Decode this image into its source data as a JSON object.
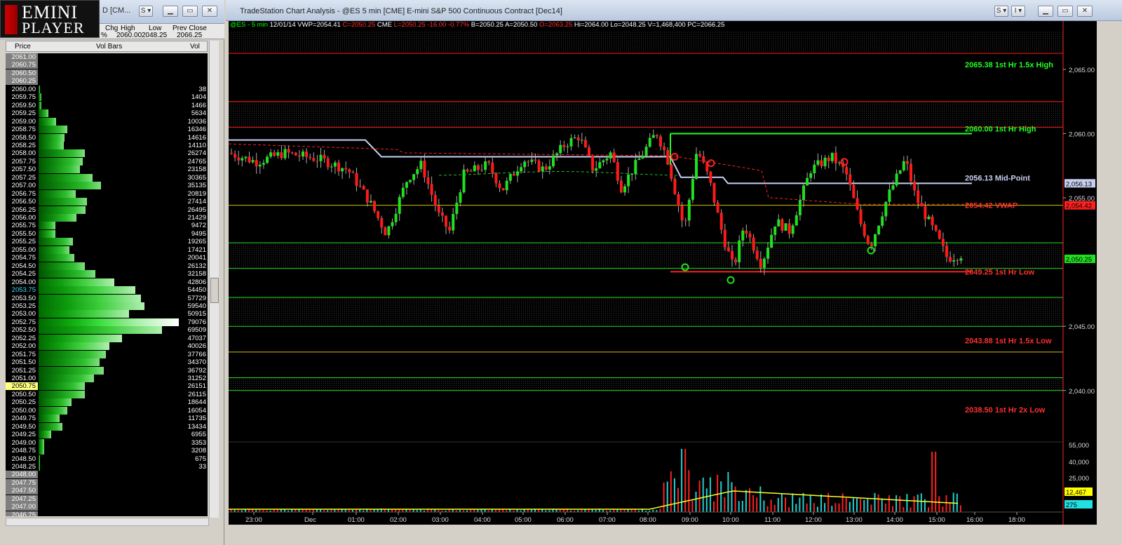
{
  "left_window": {
    "logo_line1": "EMINI",
    "logo_line2": "PLAYER",
    "title_fragment": "D [CM...",
    "header": {
      "cols": [
        "Chg",
        "High",
        "Low",
        "Prev Close"
      ],
      "vals": [
        "%",
        "2060.00",
        "2048.25",
        "2066.25"
      ]
    },
    "columns": [
      "Price",
      "Vol Bars",
      "Vol"
    ],
    "current_price": "2053.75",
    "rows": [
      {
        "price": "2061.00",
        "vol": "",
        "style": "gray"
      },
      {
        "price": "2060.75",
        "vol": "",
        "style": "gray"
      },
      {
        "price": "2060.50",
        "vol": "",
        "style": "gray"
      },
      {
        "price": "2060.25",
        "vol": "",
        "style": "gray"
      },
      {
        "price": "2060.00",
        "vol": "38"
      },
      {
        "price": "2059.75",
        "vol": "1404"
      },
      {
        "price": "2059.50",
        "vol": "1466"
      },
      {
        "price": "2059.25",
        "vol": "5634"
      },
      {
        "price": "2059.00",
        "vol": "10036"
      },
      {
        "price": "2058.75",
        "vol": "16346"
      },
      {
        "price": "2058.50",
        "vol": "14616"
      },
      {
        "price": "2058.25",
        "vol": "14110"
      },
      {
        "price": "2058.00",
        "vol": "26274"
      },
      {
        "price": "2057.75",
        "vol": "24765"
      },
      {
        "price": "2057.50",
        "vol": "23158"
      },
      {
        "price": "2057.25",
        "vol": "30365"
      },
      {
        "price": "2057.00",
        "vol": "35135"
      },
      {
        "price": "2056.75",
        "vol": "20819"
      },
      {
        "price": "2056.50",
        "vol": "27414"
      },
      {
        "price": "2056.25",
        "vol": "26495"
      },
      {
        "price": "2056.00",
        "vol": "21429"
      },
      {
        "price": "2055.75",
        "vol": "9472"
      },
      {
        "price": "2055.50",
        "vol": "9495"
      },
      {
        "price": "2055.25",
        "vol": "19265"
      },
      {
        "price": "2055.00",
        "vol": "17421"
      },
      {
        "price": "2054.75",
        "vol": "20041"
      },
      {
        "price": "2054.50",
        "vol": "26132"
      },
      {
        "price": "2054.25",
        "vol": "32158"
      },
      {
        "price": "2054.00",
        "vol": "42806"
      },
      {
        "price": "2053.75",
        "vol": "54450",
        "style": "cur"
      },
      {
        "price": "2053.50",
        "vol": "57729"
      },
      {
        "price": "2053.25",
        "vol": "59540"
      },
      {
        "price": "2053.00",
        "vol": "50915"
      },
      {
        "price": "2052.75",
        "vol": "79076"
      },
      {
        "price": "2052.50",
        "vol": "69509"
      },
      {
        "price": "2052.25",
        "vol": "47037"
      },
      {
        "price": "2052.00",
        "vol": "40026"
      },
      {
        "price": "2051.75",
        "vol": "37766"
      },
      {
        "price": "2051.50",
        "vol": "34370"
      },
      {
        "price": "2051.25",
        "vol": "36792"
      },
      {
        "price": "2051.00",
        "vol": "31252"
      },
      {
        "price": "2050.75",
        "vol": "26151",
        "style": "hi"
      },
      {
        "price": "2050.50",
        "vol": "26115"
      },
      {
        "price": "2050.25",
        "vol": "18644"
      },
      {
        "price": "2050.00",
        "vol": "16054"
      },
      {
        "price": "2049.75",
        "vol": "11735"
      },
      {
        "price": "2049.50",
        "vol": "13434"
      },
      {
        "price": "2049.25",
        "vol": "6955"
      },
      {
        "price": "2049.00",
        "vol": "3353"
      },
      {
        "price": "2048.75",
        "vol": "3208"
      },
      {
        "price": "2048.50",
        "vol": "675"
      },
      {
        "price": "2048.25",
        "vol": "33"
      },
      {
        "price": "2048.00",
        "vol": "",
        "style": "gray"
      },
      {
        "price": "2047.75",
        "vol": "",
        "style": "gray"
      },
      {
        "price": "2047.50",
        "vol": "",
        "style": "gray"
      },
      {
        "price": "2047.25",
        "vol": "",
        "style": "gray"
      },
      {
        "price": "2047.00",
        "vol": "",
        "style": "gray"
      },
      {
        "price": "2046.75",
        "vol": "",
        "style": "gray"
      }
    ]
  },
  "right_window": {
    "title": "TradeStation Chart Analysis - @ES 5 min [CME] E-mini S&P 500 Continuous Contract [Dec14]",
    "status": [
      {
        "text": "@ES - 5 min",
        "color": "#00ff00"
      },
      {
        "text": "12/01/14",
        "color": "#ffffff"
      },
      {
        "text": "VWP=2054.41",
        "color": "#ffffff"
      },
      {
        "text": "C=2050.25",
        "color": "#ff3030"
      },
      {
        "text": "CME",
        "color": "#ffffff"
      },
      {
        "text": "L=2050.25",
        "color": "#ff3030"
      },
      {
        "text": "-16.00",
        "color": "#ff3030"
      },
      {
        "text": "-0.77%",
        "color": "#ff3030"
      },
      {
        "text": "B=2050.25",
        "color": "#ffffff"
      },
      {
        "text": "A=2050.50",
        "color": "#ffffff"
      },
      {
        "text": "O=2063.25",
        "color": "#ff3030"
      },
      {
        "text": "Hi=2064.00",
        "color": "#ffffff"
      },
      {
        "text": "Lo=2048.25",
        "color": "#ffffff"
      },
      {
        "text": "V=1,468,400",
        "color": "#ffffff"
      },
      {
        "text": "PC=2066.25",
        "color": "#ffffff"
      }
    ]
  },
  "chart_data": {
    "type": "candlestick",
    "symbol": "@ES",
    "interval": "5 min",
    "ylim": [
      2036,
      2068
    ],
    "y_ticks": [
      {
        "v": 2065,
        "label": "2,065.00"
      },
      {
        "v": 2060,
        "label": "2,060.00"
      },
      {
        "v": 2055,
        "label": "2,055.00"
      },
      {
        "v": 2045,
        "label": "2,045.00"
      },
      {
        "v": 2040,
        "label": "2,040.00"
      }
    ],
    "x_ticks": [
      "23:00",
      "Dec",
      "01:00",
      "02:00",
      "03:00",
      "04:00",
      "05:00",
      "06:00",
      "07:00",
      "08:00",
      "09:00",
      "10:00",
      "11:00",
      "12:00",
      "13:00",
      "14:00",
      "15:00",
      "16:00",
      "18:00"
    ],
    "price_tags": [
      {
        "v": 2056.13,
        "label": "2,056.13",
        "bg": "#c8d0f0",
        "fg": "#000000"
      },
      {
        "v": 2054.42,
        "label": "2,054.42",
        "bg": "#ff2020",
        "fg": "#000000"
      },
      {
        "v": 2050.25,
        "label": "2,050.25",
        "bg": "#20e020",
        "fg": "#000000"
      }
    ],
    "levels": [
      {
        "label": "2065.38 1st Hr  1.5x High",
        "v": 2065.38,
        "color": "#20ff20"
      },
      {
        "label": "2060.00 1st Hr  High",
        "v": 2060.0,
        "color": "#20ff20"
      },
      {
        "label": "2056.13 Mid-Point",
        "v": 2056.13,
        "color": "#c8d0f0"
      },
      {
        "label": "2054.42 VWAP",
        "v": 2054.42,
        "color": "#ff3030"
      },
      {
        "label": "2049.25 1st Hr  Low",
        "v": 2049.25,
        "color": "#ff3030"
      },
      {
        "label": "2043.88 1st Hr  1.5x Low",
        "v": 2043.88,
        "color": "#ff3030"
      },
      {
        "label": "2038.50 1st Hr  2x Low",
        "v": 2038.5,
        "color": "#ff3030"
      }
    ],
    "volume_ticks": [
      "55,000",
      "40,000",
      "25,000"
    ],
    "volume_tags": [
      {
        "label": "12,467",
        "bg": "#ffff00"
      },
      {
        "label": "275",
        "bg": "#20e0e0"
      }
    ]
  }
}
